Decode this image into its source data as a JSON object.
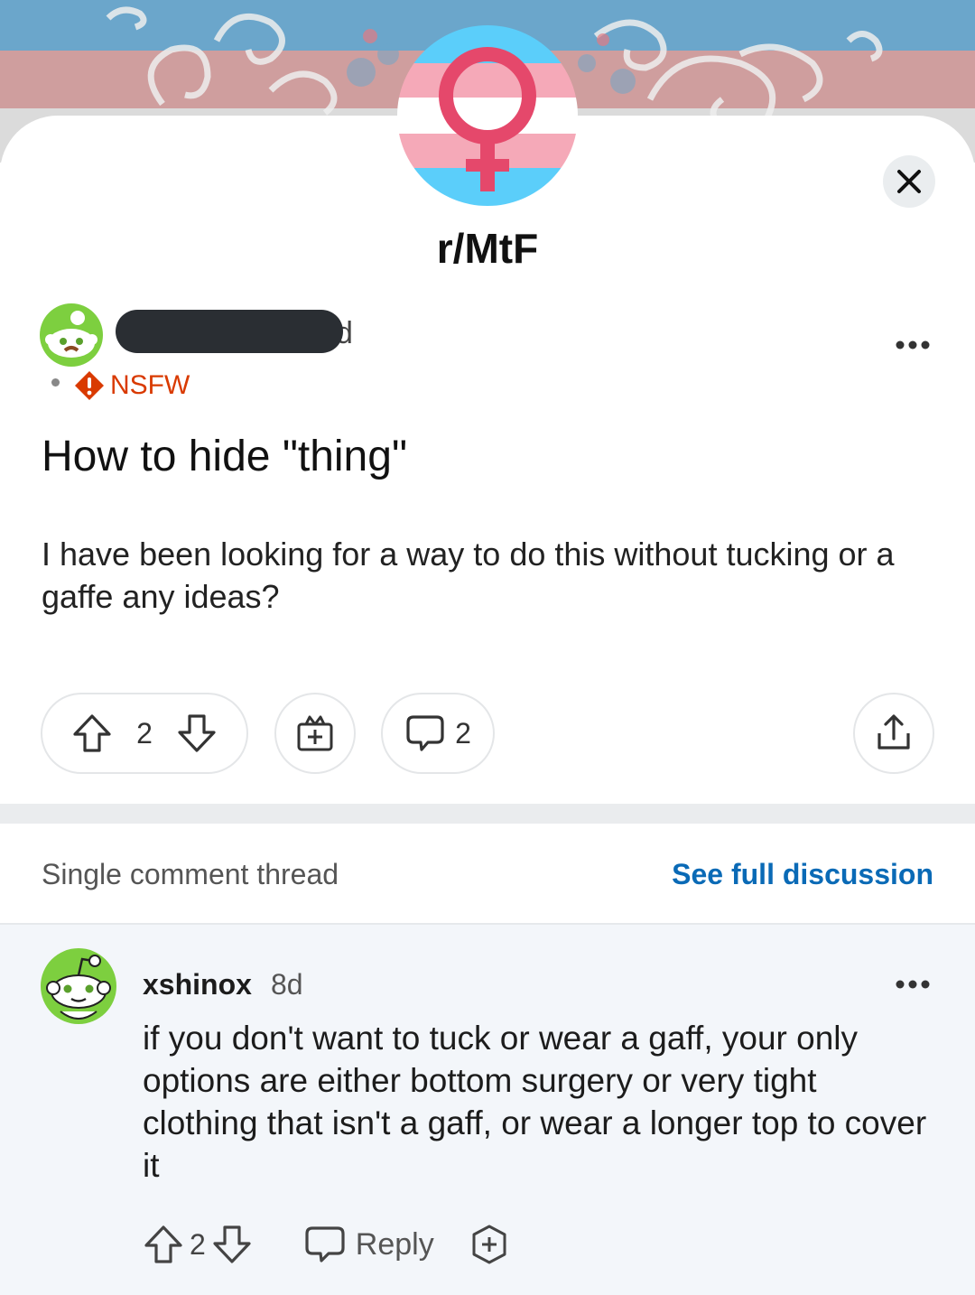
{
  "subreddit": {
    "name": "r/MtF"
  },
  "post": {
    "author_tail": "d",
    "nsfw_label": "NSFW",
    "title": "How to hide \"thing\"",
    "body": "I have been looking for a way to do this without tucking or a gaffe any ideas?",
    "vote_count": "2",
    "comment_count": "2"
  },
  "thread": {
    "label": "Single comment thread",
    "see_full": "See full discussion"
  },
  "comment": {
    "username": "xshinox",
    "age": "8d",
    "body": "if you don't want to tuck or wear a gaff, your only options are either bottom surgery or very tight clothing that isn't a gaff, or wear a longer top to cover it",
    "vote_count": "2",
    "reply_label": "Reply"
  },
  "icons": {
    "close": "close-icon",
    "more": "more-options-icon",
    "upvote": "upvote-arrow-icon",
    "downvote": "downvote-arrow-icon",
    "award": "award-icon",
    "comment": "comment-bubble-icon",
    "share": "share-icon",
    "nsfw": "nsfw-alert-icon"
  },
  "colors": {
    "trans_blue": "#5bcefa",
    "trans_pink": "#f5a9b8",
    "symbol": "#e5486b",
    "link_blue": "#0a6ab6",
    "nsfw_red": "#d93a00"
  }
}
